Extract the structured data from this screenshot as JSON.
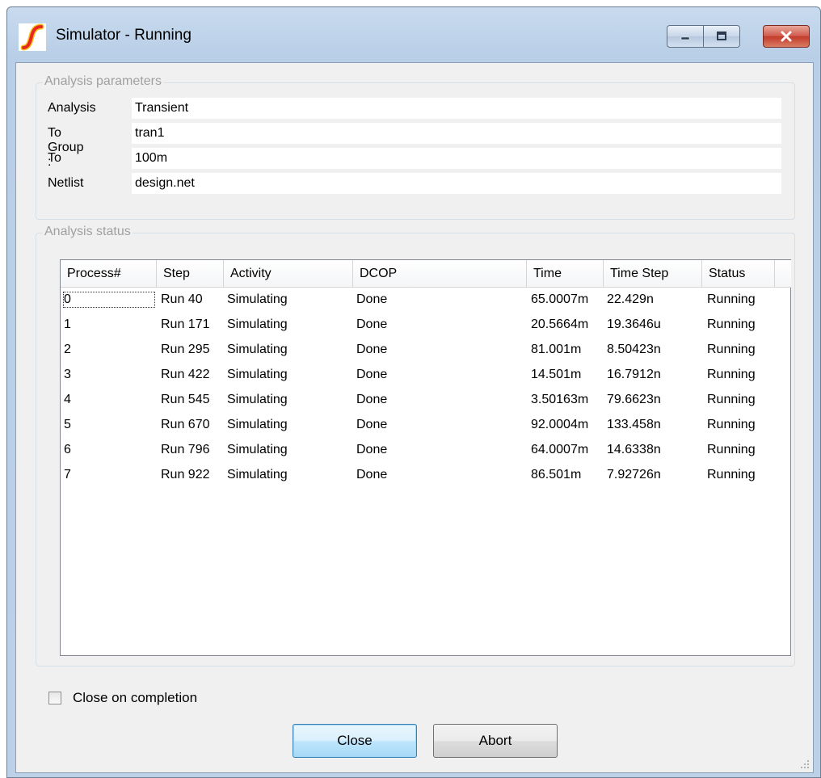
{
  "window": {
    "title": "Simulator - Running",
    "icon": "simetrix-logo-icon",
    "controls": {
      "minimize": "minimize-icon",
      "maximize": "maximize-icon",
      "close": "close-icon"
    }
  },
  "params": {
    "legend": "Analysis parameters",
    "rows": [
      {
        "label": "Analysis",
        "value": "Transient"
      },
      {
        "label": "To Group :",
        "value": "tran1"
      },
      {
        "label": "To",
        "value": "100m"
      },
      {
        "label": "Netlist",
        "value": "design.net"
      }
    ]
  },
  "status": {
    "legend": "Analysis status",
    "columns": [
      "Process#",
      "Step",
      "Activity",
      "DCOP",
      "Time",
      "Time Step",
      "Status"
    ],
    "rows": [
      [
        "0",
        "Run 40",
        "Simulating",
        "Done",
        "65.0007m",
        "22.429n",
        "Running"
      ],
      [
        "1",
        "Run 171",
        "Simulating",
        "Done",
        "20.5664m",
        "19.3646u",
        "Running"
      ],
      [
        "2",
        "Run 295",
        "Simulating",
        "Done",
        "81.001m",
        "8.50423n",
        "Running"
      ],
      [
        "3",
        "Run 422",
        "Simulating",
        "Done",
        "14.501m",
        "16.7912n",
        "Running"
      ],
      [
        "4",
        "Run 545",
        "Simulating",
        "Done",
        "3.50163m",
        "79.6623n",
        "Running"
      ],
      [
        "5",
        "Run 670",
        "Simulating",
        "Done",
        "92.0004m",
        "133.458n",
        "Running"
      ],
      [
        "6",
        "Run 796",
        "Simulating",
        "Done",
        "64.0007m",
        "14.6338n",
        "Running"
      ],
      [
        "7",
        "Run 922",
        "Simulating",
        "Done",
        "86.501m",
        "7.92726n",
        "Running"
      ]
    ]
  },
  "options": {
    "close_on_completion_label": "Close on completion",
    "close_on_completion_checked": false
  },
  "buttons": {
    "close_label": "Close",
    "abort_label": "Abort"
  },
  "colors": {
    "logo_red": "#e8281e",
    "logo_yellow": "#f6c21a",
    "close_button": "#c8463a"
  }
}
